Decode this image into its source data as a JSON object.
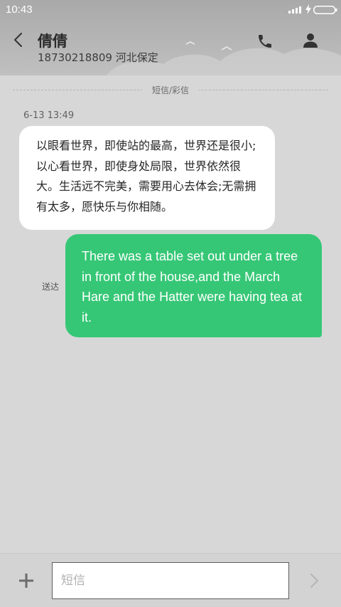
{
  "status_bar": {
    "time": "10:43",
    "signal_icon": "signal-icon",
    "charging_icon": "charging-icon",
    "battery_icon": "battery-icon"
  },
  "header": {
    "contact_name": "倩倩",
    "contact_number": "18730218809 河北保定",
    "back_icon": "back-icon",
    "phone_icon": "phone-icon",
    "person_icon": "person-icon"
  },
  "conversation": {
    "message_type_label": "短信/彩信",
    "timestamp": "6-13 13:49",
    "incoming_message": "以眼看世界，即使站的最高，世界还是很小;以心看世界，即使身处局限，世界依然很大。生活远不完美，需要用心去体会;无需拥有太多，愿快乐与你相随。",
    "outgoing_message": "There was a table set out under a tree in front of the house,and the March Hare and the Hatter were having tea at it.",
    "delivery_status": "送达"
  },
  "composer": {
    "placeholder": "短信",
    "value": "",
    "add_icon": "add-icon",
    "send_icon": "send-icon"
  },
  "colors": {
    "outgoing_bubble": "#36c776",
    "incoming_bubble": "#ffffff",
    "background": "#d7d7d7"
  }
}
